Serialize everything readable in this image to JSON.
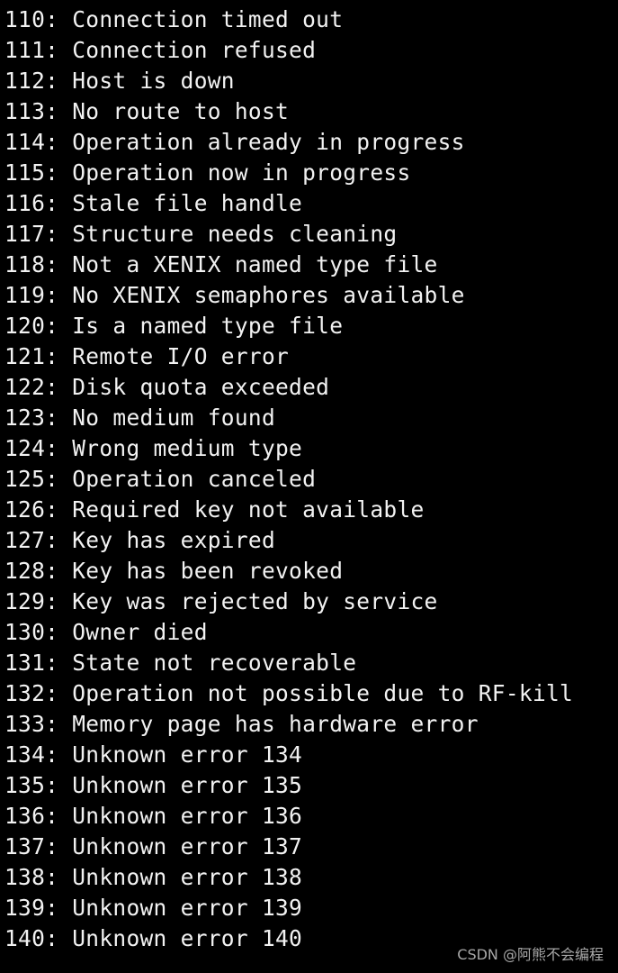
{
  "terminal": {
    "lines": [
      "110: Connection timed out",
      "111: Connection refused",
      "112: Host is down",
      "113: No route to host",
      "114: Operation already in progress",
      "115: Operation now in progress",
      "116: Stale file handle",
      "117: Structure needs cleaning",
      "118: Not a XENIX named type file",
      "119: No XENIX semaphores available",
      "120: Is a named type file",
      "121: Remote I/O error",
      "122: Disk quota exceeded",
      "123: No medium found",
      "124: Wrong medium type",
      "125: Operation canceled",
      "126: Required key not available",
      "127: Key has expired",
      "128: Key has been revoked",
      "129: Key was rejected by service",
      "130: Owner died",
      "131: State not recoverable",
      "132: Operation not possible due to RF-kill",
      "133: Memory page has hardware error",
      "134: Unknown error 134",
      "135: Unknown error 135",
      "136: Unknown error 136",
      "137: Unknown error 137",
      "138: Unknown error 138",
      "139: Unknown error 139",
      "140: Unknown error 140"
    ]
  },
  "watermark": "CSDN @阿熊不会编程",
  "colors": {
    "background": "#000000",
    "text": "#f2f2f2",
    "watermark": "#a8a8a8"
  }
}
